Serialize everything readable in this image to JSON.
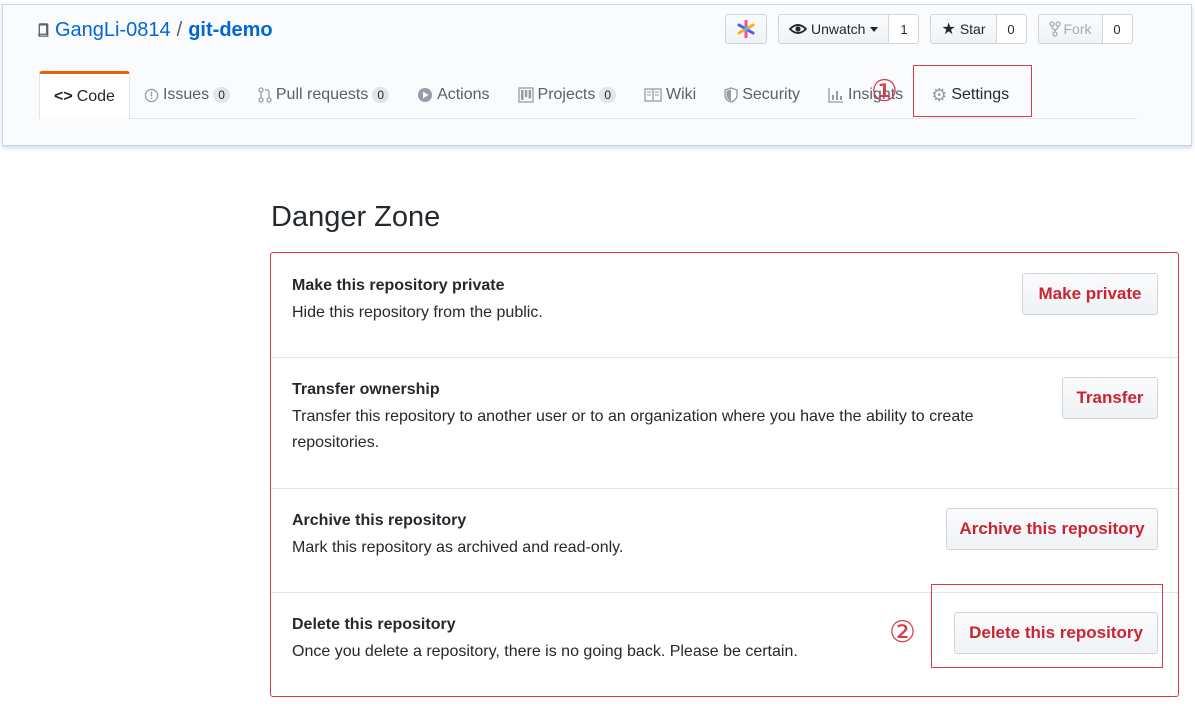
{
  "repo": {
    "owner": "GangLi-0814",
    "separator": "/",
    "name": "git-demo"
  },
  "actions": {
    "unwatch_label": "Unwatch",
    "watch_count": "1",
    "star_label": "Star",
    "star_count": "0",
    "fork_label": "Fork",
    "fork_count": "0"
  },
  "tabs": [
    {
      "label": "Code",
      "icon": "code-icon"
    },
    {
      "label": "Issues",
      "icon": "issue-icon",
      "count": "0"
    },
    {
      "label": "Pull requests",
      "icon": "pull-request-icon",
      "count": "0"
    },
    {
      "label": "Actions",
      "icon": "play-icon"
    },
    {
      "label": "Projects",
      "icon": "project-icon",
      "count": "0"
    },
    {
      "label": "Wiki",
      "icon": "book-icon"
    },
    {
      "label": "Security",
      "icon": "shield-icon"
    },
    {
      "label": "Insights",
      "icon": "graph-icon"
    },
    {
      "label": "Settings",
      "icon": "gear-icon"
    }
  ],
  "annotations": {
    "one": "①",
    "two": "②"
  },
  "danger_zone": {
    "title": "Danger Zone",
    "items": [
      {
        "name": "Make this repository private",
        "desc": "Hide this repository from the public.",
        "button": "Make private"
      },
      {
        "name": "Transfer ownership",
        "desc": "Transfer this repository to another user or to an organization where you have the ability to create repositories.",
        "button": "Transfer"
      },
      {
        "name": "Archive this repository",
        "desc": "Mark this repository as archived and read-only.",
        "button": "Archive this repository"
      },
      {
        "name": "Delete this repository",
        "desc": "Once you delete a repository, there is no going back. Please be certain.",
        "button": "Delete this repository"
      }
    ]
  },
  "colors": {
    "link": "#0366d6",
    "danger": "#cb2431",
    "annotation": "#d73a49",
    "selected_tab_accent": "#e36209"
  }
}
